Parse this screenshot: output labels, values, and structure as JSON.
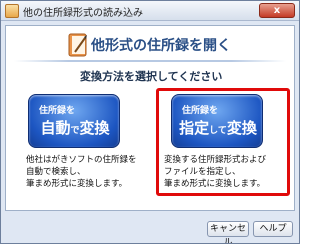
{
  "window": {
    "title": "他の住所録形式の読み込み",
    "close_label": "x"
  },
  "header": {
    "title": "他形式の住所録を開く",
    "subtitle": "変換方法を選択してください"
  },
  "options": [
    {
      "line1": "住所録を",
      "line2_a": "自動",
      "line2_b": "で",
      "line2_c": "変換",
      "description": [
        "他社はがきソフトの住所録を",
        "自動で検索し、",
        "筆まめ形式に変換します。"
      ]
    },
    {
      "line1": "住所録を",
      "line2_a": "指定",
      "line2_b": "して",
      "line2_c": "変換",
      "description": [
        "変換する住所録形式および",
        "ファイルを指定し、",
        "筆まめ形式に変換します。"
      ]
    }
  ],
  "footer": {
    "cancel_label": "キャンセル",
    "help_label": "ヘルプ"
  },
  "colors": {
    "highlight": "#e00a0a",
    "button_blue": "#1d56c2",
    "title_blue": "#2a4f86"
  },
  "icons": {
    "window": "folder-app-icon",
    "header": "address-book-icon"
  }
}
